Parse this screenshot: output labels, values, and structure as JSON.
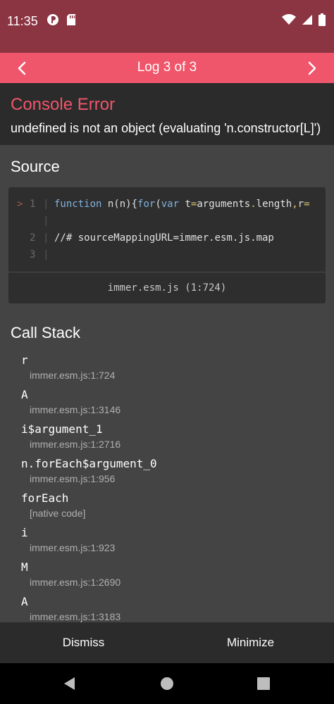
{
  "status_bar": {
    "time": "11:35"
  },
  "nav": {
    "title": "Log 3 of 3"
  },
  "error": {
    "title": "Console Error",
    "message": "undefined is not an object (evaluating 'n.constructor[L]')"
  },
  "source": {
    "heading": "Source",
    "lines": [
      {
        "marker": ">",
        "number": "1",
        "pipe": "|"
      },
      {
        "marker": "",
        "number": "",
        "pipe": "|"
      },
      {
        "marker": "",
        "number": "2",
        "pipe": "|",
        "code": "//# sourceMappingURL=immer.esm.js.map"
      },
      {
        "marker": "",
        "number": "3",
        "pipe": "|",
        "code": ""
      }
    ],
    "line1_tokens": [
      "function",
      " n(n){",
      "for",
      "(",
      "var",
      " t",
      "=",
      "arguments",
      ".",
      "length",
      ",",
      "r",
      "="
    ],
    "file": "immer.esm.js (1:724)"
  },
  "call_stack": {
    "heading": "Call Stack",
    "frames": [
      {
        "fn": "r",
        "loc": "immer.esm.js:1:724"
      },
      {
        "fn": "A",
        "loc": "immer.esm.js:1:3146"
      },
      {
        "fn": "i$argument_1",
        "loc": "immer.esm.js:1:2716"
      },
      {
        "fn": "n.forEach$argument_0",
        "loc": "immer.esm.js:1:956"
      },
      {
        "fn": "forEach",
        "loc": "[native code]"
      },
      {
        "fn": "i",
        "loc": "immer.esm.js:1:923"
      },
      {
        "fn": "M",
        "loc": "immer.esm.js:1:2690"
      },
      {
        "fn": "A",
        "loc": "immer.esm.js:1:3183"
      }
    ]
  },
  "bottom": {
    "dismiss": "Dismiss",
    "minimize": "Minimize"
  },
  "colors": {
    "status_bar_bg": "#8b3442",
    "nav_bg": "#f0566b",
    "error_title": "#f0566b",
    "content_bg": "#444444",
    "code_bg": "#2e2e2e",
    "bottom_bg": "#2b2b2b"
  },
  "icons": {
    "status_left": [
      "app-notification-icon",
      "sd-card-icon"
    ],
    "status_right": [
      "wifi-icon",
      "signal-icon",
      "battery-icon"
    ],
    "nav": [
      "chevron-left-icon",
      "chevron-right-icon"
    ],
    "android_nav": [
      "back-icon",
      "home-icon",
      "recents-icon"
    ]
  }
}
